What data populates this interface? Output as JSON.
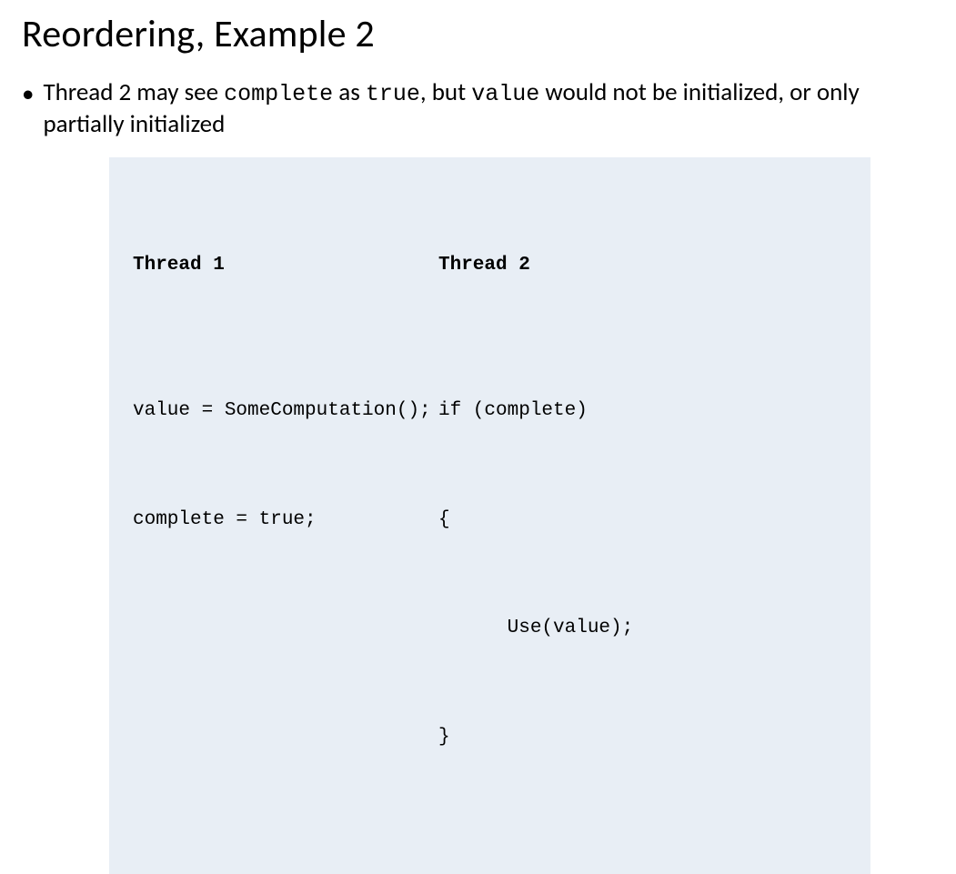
{
  "slide": {
    "title": "Reordering, Example 2",
    "bullet": {
      "segments": {
        "s0": "Thread 2 may see ",
        "s1_code": "complete",
        "s2": " as ",
        "s3_code": "true",
        "s4": ", but ",
        "s5_code": "value",
        "s6": " would not be initialized,  or only partially initialized"
      }
    },
    "code": {
      "thread1": {
        "header": "Thread 1",
        "line1": "value = SomeComputation();",
        "line2": "complete = true;"
      },
      "thread2": {
        "header": "Thread 2",
        "line1": "if (complete)",
        "line2": "{",
        "line3": "      Use(value);",
        "line4": "}"
      }
    }
  }
}
